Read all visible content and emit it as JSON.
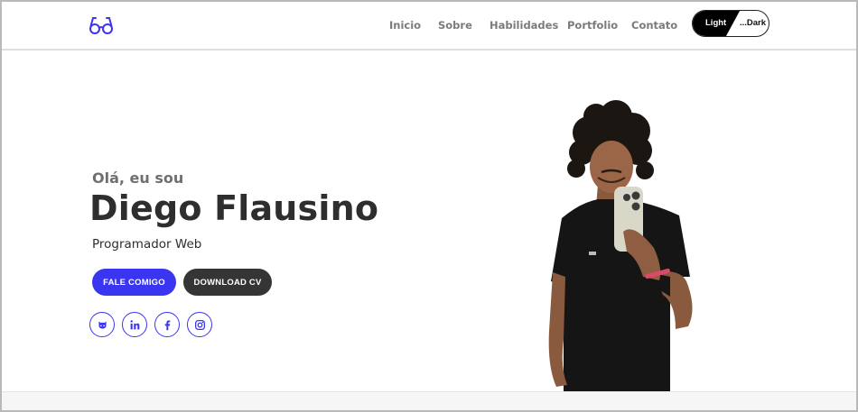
{
  "header": {
    "logo_icon": "glasses-icon",
    "nav": [
      {
        "label": "Inicio"
      },
      {
        "label": "Sobre"
      },
      {
        "label": "Habilidades"
      },
      {
        "label": "Portfolio"
      },
      {
        "label": "Contato"
      }
    ],
    "theme_toggle": {
      "light_label": "Light",
      "dark_label": "...Dark"
    }
  },
  "hero": {
    "greeting": "Olá, eu sou",
    "name": "Diego Flausino",
    "role": "Programador Web",
    "primary_button": "FALE COMIGO",
    "secondary_button": "DOWNLOAD CV",
    "socials": [
      {
        "icon": "github-icon"
      },
      {
        "icon": "linkedin-icon"
      },
      {
        "icon": "facebook-icon"
      },
      {
        "icon": "instagram-icon"
      }
    ]
  },
  "colors": {
    "accent": "#3a35f0",
    "dark_button": "#353535",
    "nav_text": "#7b7b7b",
    "heading": "#2e2e2e"
  }
}
